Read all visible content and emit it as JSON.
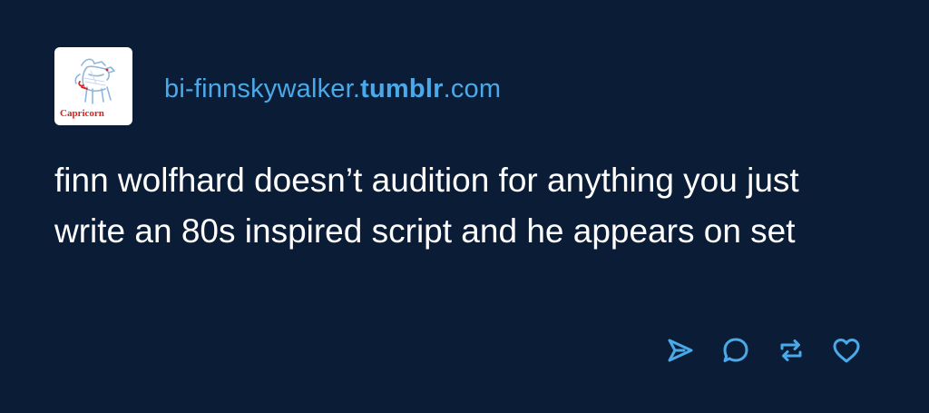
{
  "blog": {
    "name_prefix": "bi-finnskywalker.",
    "name_brand": "tumblr",
    "name_suffix": ".com",
    "avatar_caption": "Capricorn"
  },
  "post": {
    "text": "finn wolfhard doesn’t audition for anything you just write an 80s inspired script and he appears on set"
  },
  "actions": [
    {
      "icon": "send-icon"
    },
    {
      "icon": "comment-icon"
    },
    {
      "icon": "reblog-icon"
    },
    {
      "icon": "heart-icon"
    }
  ],
  "colors": {
    "background": "#0b1d36",
    "accent": "#4aa9e8",
    "text": "#ffffff",
    "avatar_caption": "#d8231f"
  }
}
